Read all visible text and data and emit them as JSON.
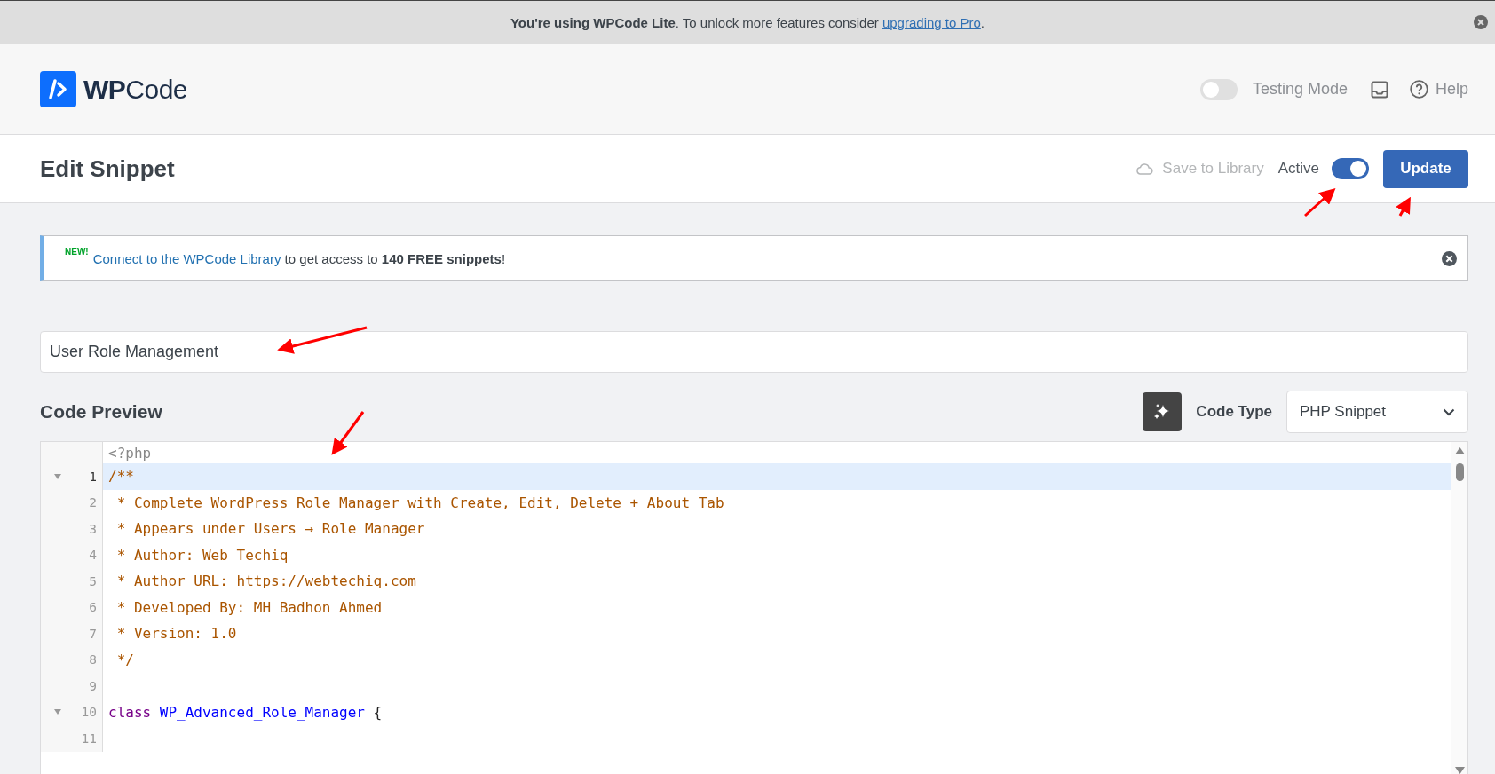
{
  "upgrade_bar": {
    "text": "**You're using WPCode Lite**. To unlock more features consider ",
    "link": "upgrading to Pro",
    "suffix": "."
  },
  "header": {
    "logo": "**WP**Code",
    "testing_mode": {
      "label": "Testing Mode",
      "on": false
    },
    "help": "Help"
  },
  "edit_bar": {
    "title": "Edit Snippet",
    "save_to_library": {
      "label": "Save to Library",
      "disabled": true
    },
    "active": {
      "label": "Active",
      "on": true
    },
    "update_button": "Update"
  },
  "library_notice": {
    "badge": "NEW!",
    "link": "Connect to the WPCode Library",
    "text": " to get access to **140 FREE snippets**!"
  },
  "snippet_title": {
    "value": "User Role Management"
  },
  "code_preview": {
    "heading": "Code Preview",
    "code_type_label": "Code Type",
    "code_type": "PHP Snippet",
    "lines": [
      {
        "foldable": false,
        "active": false,
        "tokens": [
          {
            "kind": "meta",
            "text": "<?php"
          }
        ]
      },
      {
        "number": "1",
        "foldable": true,
        "active": true,
        "tokens": [
          {
            "kind": "comment",
            "text": "/**"
          }
        ]
      },
      {
        "number": "2",
        "foldable": false,
        "active": false,
        "tokens": [
          {
            "kind": "comment",
            "text": " * Complete WordPress Role Manager with Create, Edit, Delete + About Tab"
          }
        ]
      },
      {
        "number": "3",
        "foldable": false,
        "active": false,
        "tokens": [
          {
            "kind": "comment",
            "text": " * Appears under Users → Role Manager"
          }
        ]
      },
      {
        "number": "4",
        "foldable": false,
        "active": false,
        "tokens": [
          {
            "kind": "comment",
            "text": " * Author: Web Techiq"
          }
        ]
      },
      {
        "number": "5",
        "foldable": false,
        "active": false,
        "tokens": [
          {
            "kind": "comment",
            "text": " * Author URL: https://webtechiq.com"
          }
        ]
      },
      {
        "number": "6",
        "foldable": false,
        "active": false,
        "tokens": [
          {
            "kind": "comment",
            "text": " * Developed By: MH Badhon Ahmed"
          }
        ]
      },
      {
        "number": "7",
        "foldable": false,
        "active": false,
        "tokens": [
          {
            "kind": "comment",
            "text": " * Version: 1.0"
          }
        ]
      },
      {
        "number": "8",
        "foldable": false,
        "active": false,
        "tokens": [
          {
            "kind": "comment",
            "text": " */"
          }
        ]
      },
      {
        "number": "9",
        "foldable": false,
        "active": false
      },
      {
        "number": "10",
        "foldable": true,
        "active": false,
        "tokens": [
          {
            "kind": "keyword",
            "text": "class "
          },
          {
            "kind": "def",
            "text": "WP_Advanced_Role_Manager"
          },
          {
            "kind": "plain",
            "text": " {"
          }
        ]
      },
      {
        "number": "11",
        "foldable": false,
        "active": false
      }
    ]
  }
}
